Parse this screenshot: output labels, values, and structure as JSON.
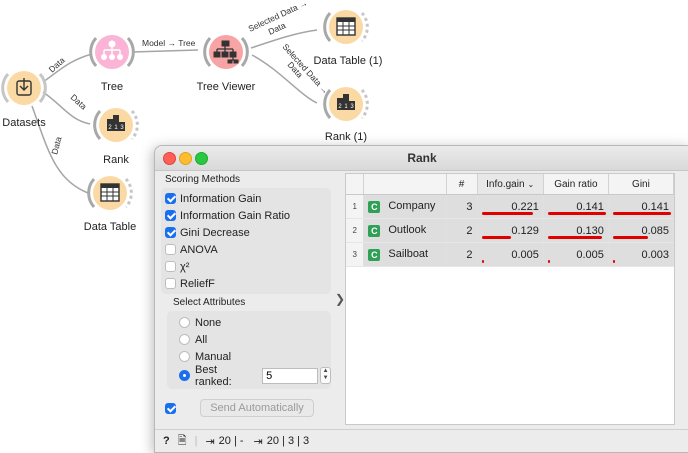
{
  "workflow": {
    "nodes": {
      "datasets": "Datasets",
      "tree": "Tree",
      "tree_viewer": "Tree Viewer",
      "data_table_1": "Data Table (1)",
      "rank_1": "Rank (1)",
      "rank": "Rank",
      "data_table": "Data Table"
    },
    "edges": {
      "datasets_tree": "Data",
      "datasets_rank": "Data",
      "datasets_table": "Data",
      "tree_viewer": "Model → Tree",
      "viewer_table_1": "Selected Data →",
      "viewer_table_2": "Data",
      "viewer_rank_1": "Selected Data →",
      "viewer_rank_2": "Data"
    },
    "node_color": "#fbd9a4"
  },
  "window": {
    "title": "Rank",
    "scoring_title": "Scoring Methods",
    "scoring": [
      {
        "label": "Information Gain",
        "checked": true
      },
      {
        "label": "Information Gain Ratio",
        "checked": true
      },
      {
        "label": "Gini Decrease",
        "checked": true
      },
      {
        "label": "ANOVA",
        "checked": false
      },
      {
        "label": "χ²",
        "checked": false
      },
      {
        "label": "ReliefF",
        "checked": false
      }
    ],
    "select_title": "Select Attributes",
    "select_options": [
      {
        "label": "None",
        "selected": false
      },
      {
        "label": "All",
        "selected": false
      },
      {
        "label": "Manual",
        "selected": false
      },
      {
        "label": "Best ranked:",
        "selected": true
      }
    ],
    "best_ranked_value": "5",
    "send_label": "Send Automatically",
    "send_checked": true
  },
  "table": {
    "headers": [
      "#",
      "Info.gain",
      "Gain ratio",
      "Gini"
    ],
    "rows": [
      {
        "num": "1",
        "name": "Company",
        "count": "3",
        "info": "0.221",
        "ratio": "0.141",
        "gini": "0.141",
        "fill": [
          0.88,
          1.0,
          1.0
        ]
      },
      {
        "num": "2",
        "name": "Outlook",
        "count": "2",
        "info": "0.129",
        "ratio": "0.130",
        "gini": "0.085",
        "fill": [
          0.5,
          0.93,
          0.6
        ]
      },
      {
        "num": "3",
        "name": "Sailboat",
        "count": "2",
        "info": "0.005",
        "ratio": "0.005",
        "gini": "0.003",
        "fill": [
          0.02,
          0.02,
          0.02
        ]
      }
    ],
    "bar_color": "#e00000"
  },
  "status": {
    "input": "20 | -",
    "output": "20 | 3 | 3"
  }
}
